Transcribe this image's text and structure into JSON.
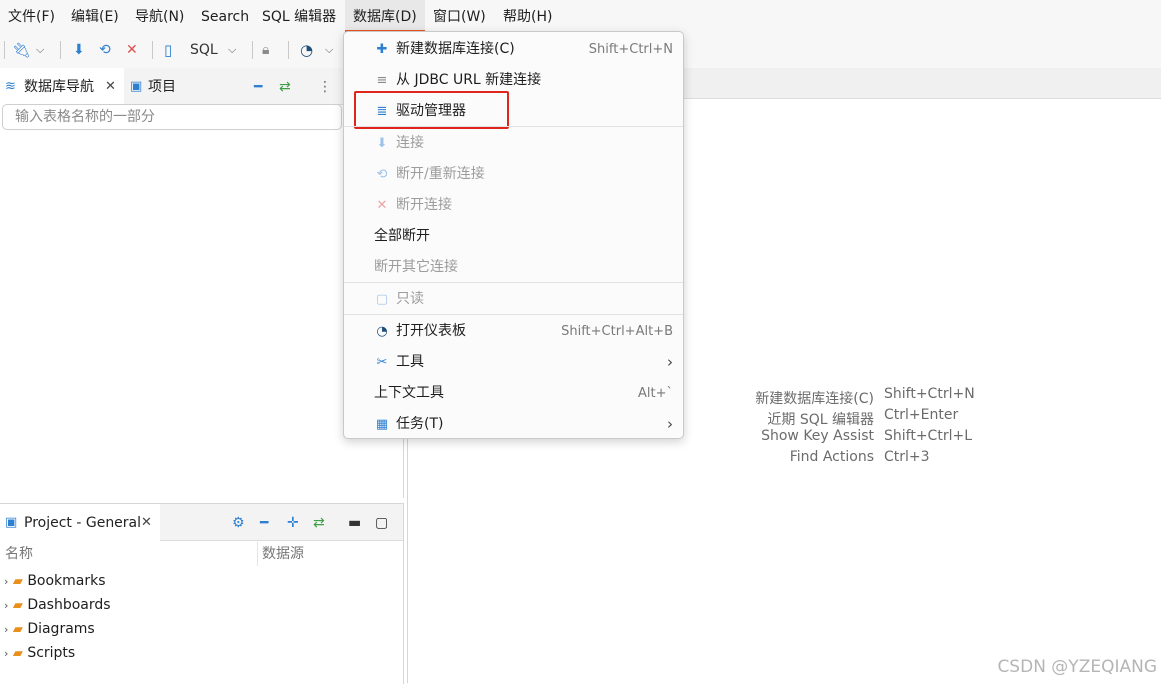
{
  "menubar": {
    "items": [
      "文件(F)",
      "编辑(E)",
      "导航(N)",
      "Search",
      "SQL 编辑器",
      "数据库(D)",
      "窗口(W)",
      "帮助(H)"
    ]
  },
  "toolbar": {
    "sql_label": "SQL"
  },
  "navigator": {
    "tab_db_nav": "数据库导航",
    "tab_project": "项目",
    "filter_placeholder": "输入表格名称的一部分"
  },
  "project_panel": {
    "tab_label": "Project - General",
    "col_name": "名称",
    "col_datasource": "数据源",
    "items": [
      "Bookmarks",
      "Dashboards",
      "Diagrams",
      "Scripts"
    ]
  },
  "database_menu": {
    "items": [
      {
        "label": "新建数据库连接(C)",
        "shortcut": "Shift+Ctrl+N",
        "icon": "plug-plus-icon",
        "enabled": true
      },
      {
        "label": "从 JDBC URL 新建连接",
        "shortcut": "",
        "icon": "database-stack-icon",
        "enabled": true
      },
      {
        "label": "驱动管理器",
        "shortcut": "",
        "icon": "driver-manager-icon",
        "enabled": true
      },
      {
        "label": "连接",
        "shortcut": "",
        "icon": "plug-icon",
        "enabled": false
      },
      {
        "label": "断开/重新连接",
        "shortcut": "",
        "icon": "reconnect-icon",
        "enabled": false
      },
      {
        "label": "断开连接",
        "shortcut": "",
        "icon": "disconnect-icon",
        "enabled": false
      },
      {
        "label": "全部断开",
        "shortcut": "",
        "icon": "",
        "enabled": true
      },
      {
        "label": "断开其它连接",
        "shortcut": "",
        "icon": "",
        "enabled": false
      },
      {
        "label": "只读",
        "shortcut": "",
        "icon": "lock-icon",
        "enabled": false
      },
      {
        "label": "打开仪表板",
        "shortcut": "Shift+Ctrl+Alt+B",
        "icon": "dashboard-icon",
        "enabled": true
      },
      {
        "label": "工具",
        "shortcut": "",
        "icon": "tools-icon",
        "enabled": true,
        "submenu": true
      },
      {
        "label": "上下文工具",
        "shortcut": "Alt+`",
        "icon": "",
        "enabled": true
      },
      {
        "label": "任务(T)",
        "shortcut": "",
        "icon": "tasks-icon",
        "enabled": true,
        "submenu": true
      }
    ]
  },
  "editor_hints": [
    {
      "action": "新建数据库连接(C)",
      "keys": "Shift+Ctrl+N"
    },
    {
      "action": "近期 SQL 编辑器",
      "keys": "Ctrl+Enter"
    },
    {
      "action": "Show Key Assist",
      "keys": "Shift+Ctrl+L"
    },
    {
      "action": "Find Actions",
      "keys": "Ctrl+3"
    }
  ],
  "watermark": "CSDN @YZEQIANG",
  "colors": {
    "highlight_box": "#e0251c",
    "active_menu_underline": "#e95420"
  }
}
